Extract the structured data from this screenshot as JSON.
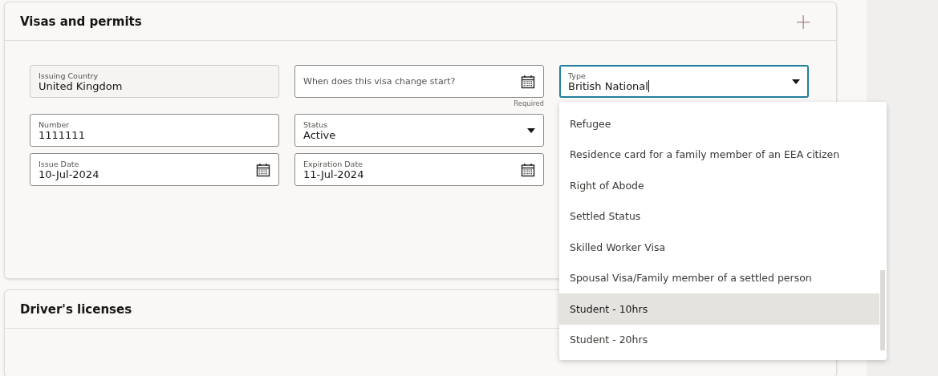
{
  "sections": [
    {
      "title": "Visas and permits",
      "add_button": "+",
      "fields": [
        {
          "kind": "readonly",
          "label": "Issuing Country",
          "value": "United Kingdom",
          "focused": false
        },
        {
          "kind": "date",
          "placeholder": "When does this visa change start?",
          "helper": "Required",
          "focused": false
        },
        {
          "kind": "select",
          "label": "Type",
          "value": "British National",
          "focused": true
        },
        {
          "kind": "text",
          "label": "Number",
          "value": "1111111",
          "focused": false
        },
        {
          "kind": "select",
          "label": "Status",
          "value": "Active",
          "focused": false
        },
        {
          "kind": "spacer"
        },
        {
          "kind": "date",
          "label": "Issue Date",
          "value": "10-Jul-2024",
          "focused": false
        },
        {
          "kind": "date",
          "label": "Expiration Date",
          "value": "11-Jul-2024",
          "focused": false
        }
      ]
    },
    {
      "title": "Driver's licenses"
    }
  ],
  "dropdown": {
    "options": [
      {
        "label": "Refugee",
        "selected": false
      },
      {
        "label": "Residence card for a family member of an EEA citizen",
        "selected": false
      },
      {
        "label": "Right of Abode",
        "selected": false
      },
      {
        "label": "Settled Status",
        "selected": false
      },
      {
        "label": "Skilled Worker Visa",
        "selected": false
      },
      {
        "label": "Spousal Visa/Family member of a settled person",
        "selected": false
      },
      {
        "label": "Student - 10hrs",
        "selected": true
      },
      {
        "label": "Student - 20hrs",
        "selected": false
      }
    ]
  }
}
